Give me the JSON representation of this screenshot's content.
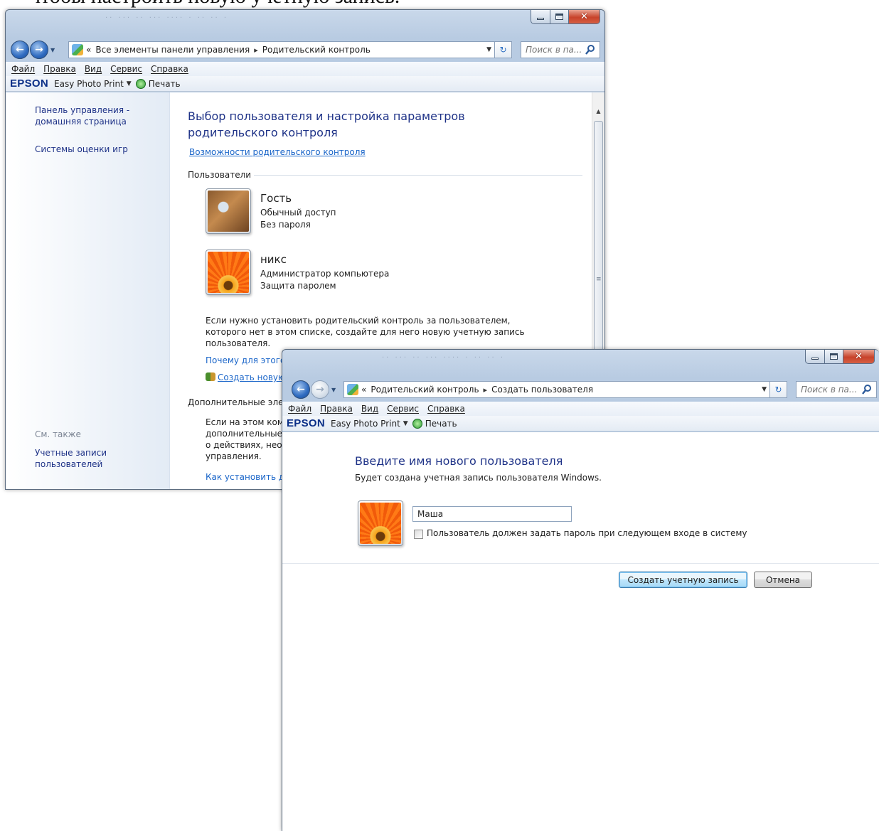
{
  "doc_heading": "чтобы настроить новую учетную запись.",
  "window1": {
    "address": {
      "prefix": "«",
      "crumbs": [
        "Все элементы панели управления",
        "Родительский контроль"
      ]
    },
    "search_placeholder": "Поиск в па...",
    "menu": [
      "Файл",
      "Правка",
      "Вид",
      "Сервис",
      "Справка"
    ],
    "toolbar": {
      "brand": "EPSON",
      "app": "Easy Photo Print",
      "print": "Печать"
    },
    "sidebar": {
      "home_line1": "Панель управления -",
      "home_line2": "домашняя страница",
      "game_ratings": "Системы оценки игр",
      "see_also": "См. также",
      "accounts_line1": "Учетные записи",
      "accounts_line2": "пользователей"
    },
    "main": {
      "title_line1": "Выбор пользователя и настройка параметров",
      "title_line2": "родительского контроля",
      "features_link": "Возможности родительского контроля",
      "users_section": "Пользователи",
      "users": [
        {
          "name": "Гость",
          "type": "Обычный доступ",
          "password": "Без пароля",
          "picture": "guest-briefcase"
        },
        {
          "name": "никс",
          "type": "Администратор компьютера",
          "password": "Защита паролем",
          "picture": "orange-flower"
        }
      ],
      "info_line1": "Если нужно установить родительский контроль за пользователем,",
      "info_line2": "которого нет в этом списке, создайте для него новую учетную запись",
      "info_line3": "пользователя.",
      "why_link": "Почему для этого",
      "create_link": "Создать новую",
      "extra_section": "Дополнительные эле",
      "extra_line1": "Если на этом ком",
      "extra_line2": "дополнительные",
      "extra_line3": "о действиях, необ",
      "extra_line4": "управления.",
      "howto_link": "Как установить до"
    }
  },
  "window2": {
    "address": {
      "prefix": "«",
      "crumbs": [
        "Родительский контроль",
        "Создать пользователя"
      ]
    },
    "search_placeholder": "Поиск в па...",
    "menu": [
      "Файл",
      "Правка",
      "Вид",
      "Сервис",
      "Справка"
    ],
    "toolbar": {
      "brand": "EPSON",
      "app": "Easy Photo Print",
      "print": "Печать"
    },
    "title": "Введите имя нового пользователя",
    "subtitle": "Будет создана учетная запись пользователя Windows.",
    "name_value": "Маша",
    "password_checkbox": "Пользователь должен задать пароль при следующем входе в систему",
    "password_checked": false,
    "create_button": "Создать учетную запись",
    "cancel_button": "Отмена"
  },
  "colors": {
    "link": "#1b66c9",
    "heading": "#1e3287",
    "frame": "#b8cbe2"
  },
  "icons": [
    "back-arrow-icon",
    "forward-arrow-icon",
    "control-panel-icon",
    "refresh-icon",
    "search-icon",
    "printer-icon",
    "help-icon",
    "users-icon"
  ]
}
